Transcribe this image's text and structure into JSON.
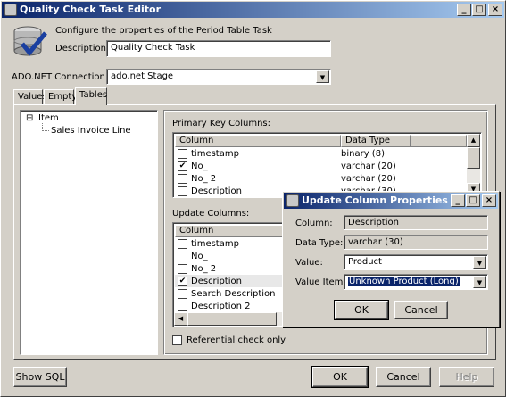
{
  "window": {
    "title": "Quality Check Task Editor",
    "minimize": "_",
    "maximize": "□",
    "close": "×"
  },
  "header": {
    "intro": "Configure the properties of the Period Table Task",
    "description_label": "Description:",
    "description_value": "Quality Check Task"
  },
  "connection": {
    "label": "ADO.NET Connection:",
    "value": "ado.net Stage"
  },
  "tabs": [
    {
      "label": "Values",
      "active": false
    },
    {
      "label": "Empty",
      "active": false
    },
    {
      "label": "Tables",
      "active": true
    }
  ],
  "tree": {
    "expander": "⊟",
    "root": "Item",
    "children": [
      "Sales Invoice Line"
    ]
  },
  "primary_keys": {
    "label": "Primary Key Columns:",
    "headers": [
      "Column",
      "Data Type"
    ],
    "rows": [
      {
        "checked": false,
        "column": "timestamp",
        "type": "binary (8)"
      },
      {
        "checked": true,
        "column": "No_",
        "type": "varchar (20)"
      },
      {
        "checked": false,
        "column": "No_ 2",
        "type": "varchar (20)"
      },
      {
        "checked": false,
        "column": "Description",
        "type": "varchar (30)"
      }
    ]
  },
  "update_columns": {
    "label": "Update Columns:",
    "headers": [
      "Column"
    ],
    "rows": [
      {
        "checked": false,
        "column": "timestamp"
      },
      {
        "checked": false,
        "column": "No_"
      },
      {
        "checked": false,
        "column": "No_ 2"
      },
      {
        "checked": true,
        "column": "Description",
        "selected": true
      },
      {
        "checked": false,
        "column": "Search Description"
      },
      {
        "checked": false,
        "column": "Description 2"
      }
    ]
  },
  "referential_check": {
    "label": "Referential check only",
    "checked": false
  },
  "buttons": {
    "show_sql": "Show SQL",
    "ok": "OK",
    "cancel": "Cancel",
    "help": "Help"
  },
  "dialog": {
    "title": "Update Column Properties",
    "column_label": "Column:",
    "column_value": "Description",
    "datatype_label": "Data Type:",
    "datatype_value": "varchar (30)",
    "value_label": "Value:",
    "value_value": "Product",
    "valueitem_label": "Value Item:",
    "valueitem_value": "Unknown Product (Long)",
    "ok": "OK",
    "cancel": "Cancel"
  },
  "glyphs": {
    "dropdown": "▼",
    "up": "▲",
    "down": "▼",
    "left": "◀",
    "right": "▶",
    "check": "✔"
  }
}
